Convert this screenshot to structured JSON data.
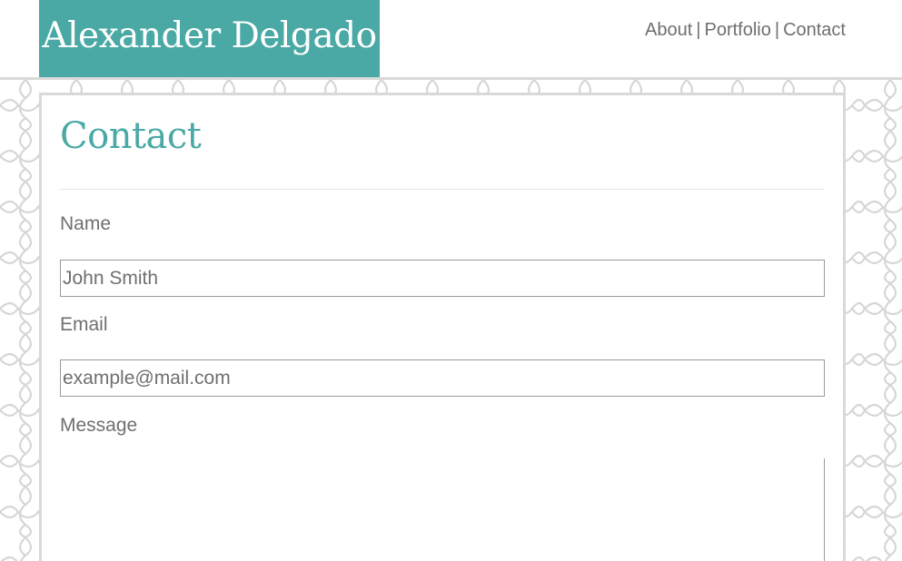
{
  "header": {
    "brand": "Alexander Delgado",
    "nav": {
      "about": "About",
      "portfolio": "Portfolio",
      "contact": "Contact",
      "separator": "|"
    }
  },
  "main": {
    "title": "Contact",
    "form": {
      "name_label": "Name",
      "name_placeholder": "John Smith",
      "email_label": "Email",
      "email_placeholder": "example@mail.com",
      "message_label": "Message",
      "message_value": ""
    }
  },
  "colors": {
    "accent": "#4aa9a5",
    "text": "#6f6f6f",
    "border": "#d9d9d9",
    "pattern": "#d6d6d6"
  }
}
